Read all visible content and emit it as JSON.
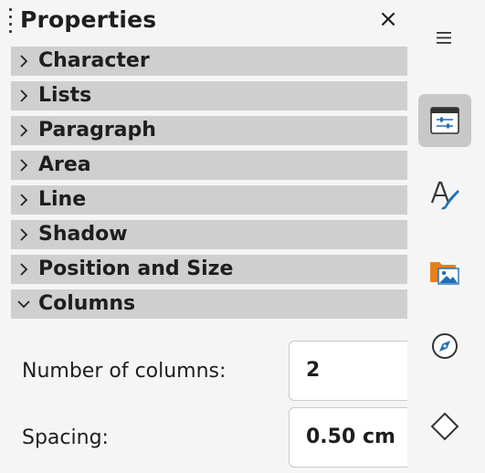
{
  "panel": {
    "title": "Properties",
    "close_glyph": "×",
    "sections": [
      {
        "label": "Character",
        "expanded": false
      },
      {
        "label": "Lists",
        "expanded": false
      },
      {
        "label": "Paragraph",
        "expanded": false
      },
      {
        "label": "Area",
        "expanded": false
      },
      {
        "label": "Line",
        "expanded": false
      },
      {
        "label": "Shadow",
        "expanded": false
      },
      {
        "label": "Position and Size",
        "expanded": false
      },
      {
        "label": "Columns",
        "expanded": true
      }
    ],
    "columns": {
      "number_label": "Number of columns:",
      "number_value": "2",
      "spacing_label": "Spacing:",
      "spacing_value": "0.50 cm"
    }
  },
  "tabbar": {
    "items": [
      {
        "icon": "hamburger-menu-icon",
        "active": false
      },
      {
        "icon": "properties-icon",
        "active": true
      },
      {
        "icon": "styles-icon",
        "active": false
      },
      {
        "icon": "gallery-icon",
        "active": false
      },
      {
        "icon": "navigator-icon",
        "active": false
      },
      {
        "icon": "shapes-icon",
        "active": false
      }
    ]
  },
  "colors": {
    "section_header": "#cfcfcf",
    "active_tab": "#c8c8c8",
    "background": "#f5f5f5",
    "accent_blue": "#1f6fb5",
    "folder_orange": "#e8801a"
  }
}
